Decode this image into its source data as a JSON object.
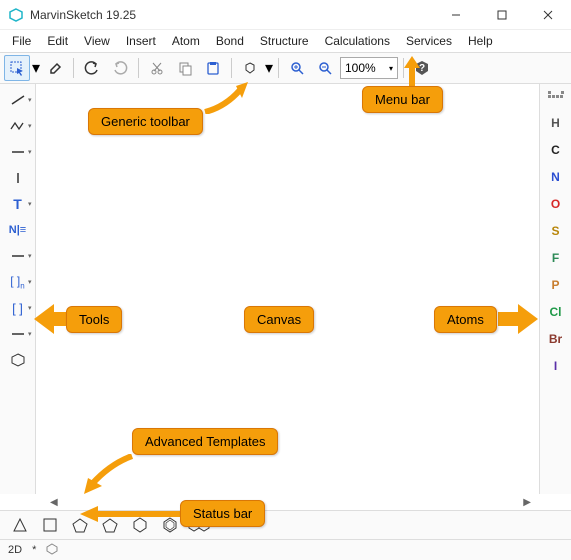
{
  "window": {
    "title": "MarvinSketch 19.25"
  },
  "menu": [
    "File",
    "Edit",
    "View",
    "Insert",
    "Atom",
    "Bond",
    "Structure",
    "Calculations",
    "Services",
    "Help"
  ],
  "toolbar": {
    "zoom": "100%"
  },
  "atoms": [
    {
      "sym": "H",
      "cls": "c-H"
    },
    {
      "sym": "C",
      "cls": "c-C"
    },
    {
      "sym": "N",
      "cls": "c-N"
    },
    {
      "sym": "O",
      "cls": "c-O"
    },
    {
      "sym": "S",
      "cls": "c-S"
    },
    {
      "sym": "F",
      "cls": "c-F"
    },
    {
      "sym": "P",
      "cls": "c-P"
    },
    {
      "sym": "Cl",
      "cls": "c-Cl"
    },
    {
      "sym": "Br",
      "cls": "c-Br"
    },
    {
      "sym": "I",
      "cls": "c-I"
    }
  ],
  "left_tools": [
    {
      "id": "line-tool"
    },
    {
      "id": "zigzag-tool"
    },
    {
      "id": "dash-tool"
    },
    {
      "id": "vline-tool"
    },
    {
      "id": "text-tool",
      "label": "T",
      "color": "#2c4fd1"
    },
    {
      "id": "name-tool",
      "label": "N≡",
      "color": "#2c4fd1"
    },
    {
      "id": "dash2-tool"
    },
    {
      "id": "bracket-n-tool",
      "label": "[ ]ₙ",
      "color": "#2c4fd1"
    },
    {
      "id": "bracket-tool",
      "label": "[ ]",
      "color": "#2c4fd1"
    },
    {
      "id": "dash3-tool"
    },
    {
      "id": "hex-tool"
    }
  ],
  "status": {
    "mode": "2D",
    "mark": "*"
  },
  "callouts": {
    "menu": "Menu bar",
    "generic": "Generic toolbar",
    "tools": "Tools",
    "canvas": "Canvas",
    "atoms": "Atoms",
    "templates": "Advanced Templates",
    "status": "Status bar"
  }
}
